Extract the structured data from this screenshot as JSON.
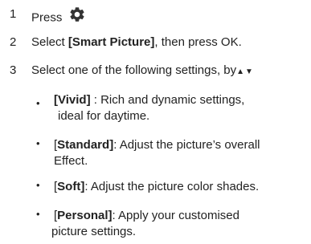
{
  "steps": [
    {
      "number": "1",
      "text": "Press",
      "icon": "settings-gear-icon"
    },
    {
      "number": "2",
      "prefix": "Select ",
      "bold": "[Smart Picture]",
      "suffix": ", then press OK."
    },
    {
      "number": "3",
      "text": "Select one of the following settings, by",
      "arrows": "▲▼"
    }
  ],
  "options": [
    {
      "bold": "[Vivid]",
      "desc": " : Rich and dynamic settings,",
      "desc2": "ideal for daytime."
    },
    {
      "open": "[",
      "bold": "Standard",
      "close": "]",
      "desc": ": Adjust the picture’s overall",
      "desc2": "Effect."
    },
    {
      "open": "[",
      "bold": "Soft",
      "close": "]",
      "desc": ": Adjust the picture color shades."
    },
    {
      "open": "[",
      "bold": "Personal",
      "close": "]",
      "desc": ": Apply your customised",
      "desc2": "picture settings."
    }
  ],
  "bullet": "•"
}
